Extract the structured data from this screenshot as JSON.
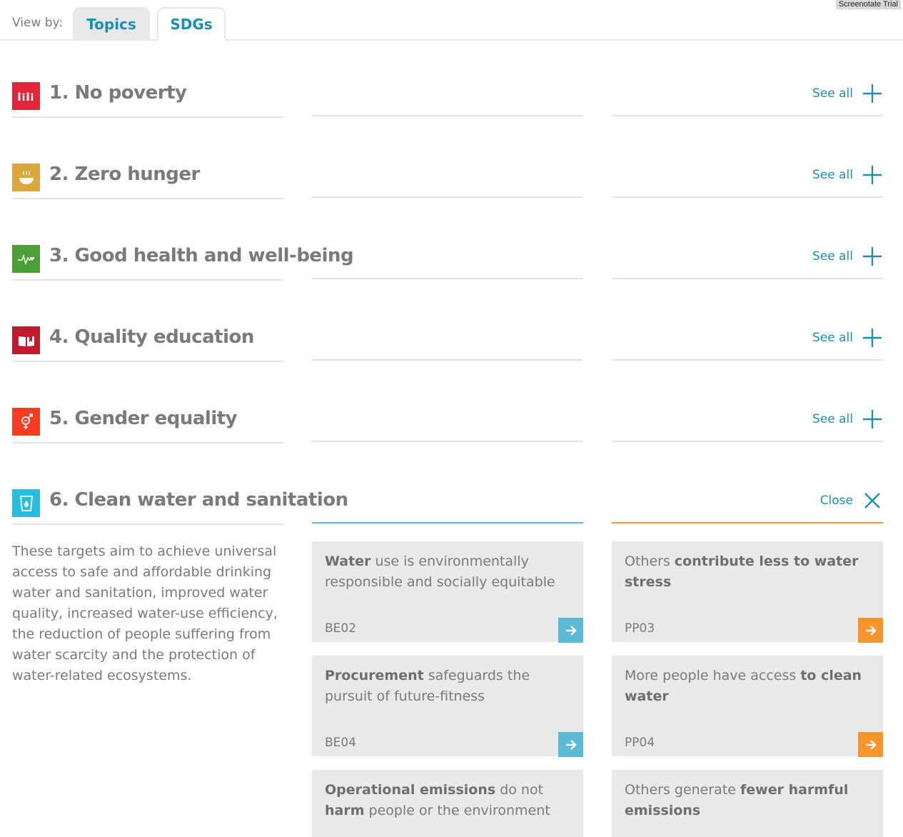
{
  "watermark": "Screenotate Trial",
  "view_by": {
    "label": "View by:",
    "tabs": [
      {
        "label": "Topics",
        "active": false
      },
      {
        "label": "SDGs",
        "active": true
      }
    ]
  },
  "sdgs": [
    {
      "title": "1. No poverty",
      "color": "#e5243b",
      "icon": "people-icon",
      "action": "See all"
    },
    {
      "title": "2. Zero hunger",
      "color": "#dda63a",
      "icon": "bowl-icon",
      "action": "See all"
    },
    {
      "title": "3. Good health and well-being",
      "color": "#4c9f38",
      "icon": "heartbeat-icon",
      "action": "See all"
    },
    {
      "title": "4. Quality education",
      "color": "#c5192d",
      "icon": "book-icon",
      "action": "See all"
    },
    {
      "title": "5. Gender equality",
      "color": "#ff3a21",
      "icon": "gender-icon",
      "action": "See all"
    },
    {
      "title": "6. Clean water and sanitation",
      "color": "#26bde2",
      "icon": "water-glass-icon",
      "action": "Close"
    }
  ],
  "expanded": {
    "description": "These targets aim to achieve universal access to safe and affordable drinking water and sanitation, improved water quality, increased water-use efficiency, the reduction of people suffering from water scarcity and the protection of water-related ecosystems.",
    "col1_accent": "#5bbbd7",
    "col2_accent": "#f7942c",
    "cards": [
      {
        "bold1": "Water",
        "text1": " use is environmentally responsible and socially equitable",
        "bold2": "",
        "text2": "",
        "code": "BE02",
        "accent": "blue"
      },
      {
        "bold1": "",
        "text1": "Others ",
        "bold2": "contribute less to water stress",
        "text2": "",
        "code": "PP03",
        "accent": "orange"
      },
      {
        "bold1": "Procurement",
        "text1": " safeguards the pursuit of future-fitness",
        "bold2": "",
        "text2": "",
        "code": "BE04",
        "accent": "blue"
      },
      {
        "bold1": "",
        "text1": "More people have access ",
        "bold2": "to clean water",
        "text2": "",
        "code": "PP04",
        "accent": "orange"
      },
      {
        "bold1": "Operational emissions",
        "text1": " do not ",
        "bold2": "harm",
        "text2": " people or the environment",
        "code": "",
        "accent": "blue"
      },
      {
        "bold1": "",
        "text1": "Others generate ",
        "bold2": "fewer harmful emissions",
        "text2": "",
        "code": "",
        "accent": "orange"
      }
    ]
  }
}
